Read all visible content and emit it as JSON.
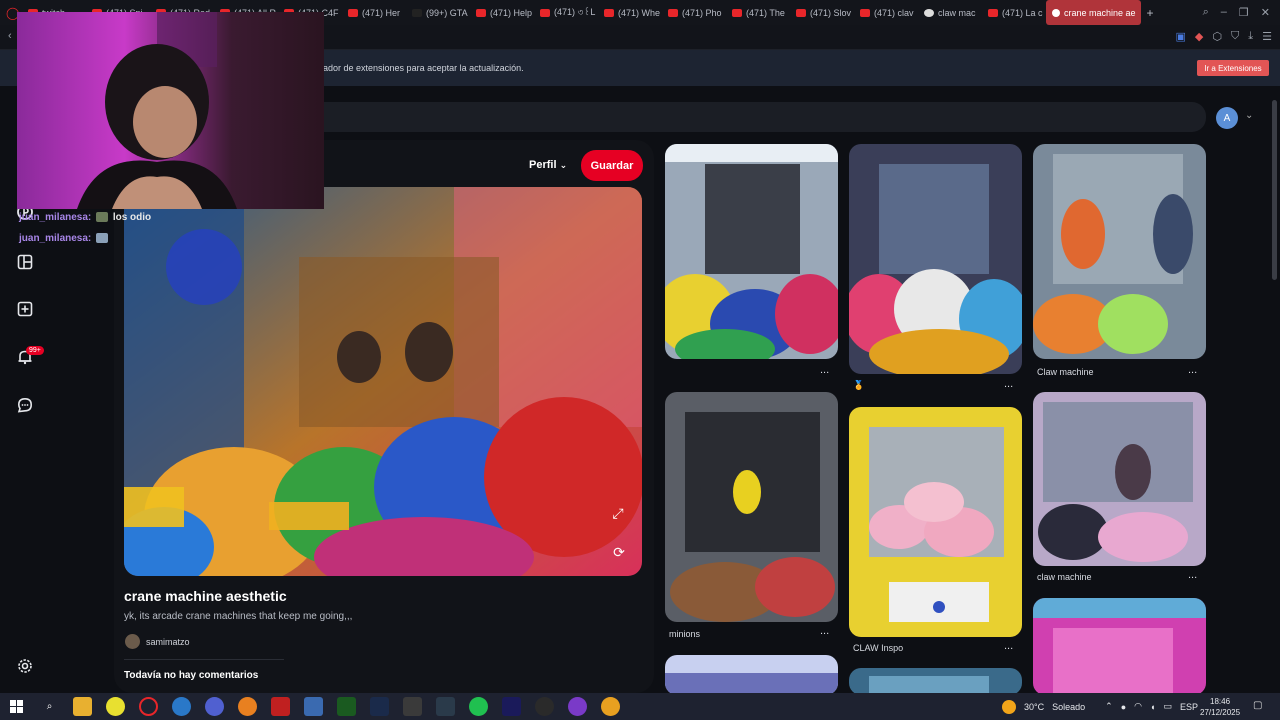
{
  "browser": {
    "tabs": [
      {
        "label": "twitch"
      },
      {
        "label": "(471) Spi"
      },
      {
        "label": "(471) Red"
      },
      {
        "label": "(471) All R"
      },
      {
        "label": "(471) C4F"
      },
      {
        "label": "(471) Her"
      },
      {
        "label": "(99+) GTA"
      },
      {
        "label": "(471) Help"
      },
      {
        "label": "(471) ৩꒰L"
      },
      {
        "label": "(471) Whe"
      },
      {
        "label": "(471) Pho"
      },
      {
        "label": "(471) The"
      },
      {
        "label": "(471) Slov"
      },
      {
        "label": "(471) clav"
      },
      {
        "label": "claw mac"
      },
      {
        "label": "(471) La c"
      }
    ],
    "active_tab": "crane machine ae",
    "new_tab": "+"
  },
  "notice": {
    "text": "ador de extensiones para aceptar la actualización.",
    "button": "Ir a Extensiones"
  },
  "account": {
    "initial": "A"
  },
  "rail": {
    "notifications_badge": "99+"
  },
  "pin": {
    "profile_label": "Perfil",
    "save_label": "Guardar",
    "title": "crane machine aesthetic",
    "description": "yk, its arcade crane machines that keep me going,,,",
    "author": "samimatzo",
    "comments": "Todavía no hay comentarios"
  },
  "chat": [
    {
      "user": "juan_milanesa:",
      "msg": "los odio"
    },
    {
      "user": "juan_milanesa:",
      "msg": ""
    }
  ],
  "grid": {
    "captions": {
      "c2": "🏅",
      "c3": "Claw machine",
      "c4": "minions",
      "c5": "CLAW Inspo",
      "c6": "claw machine"
    },
    "more": "..."
  },
  "taskbar": {
    "temperature": "30°C",
    "weather": "Soleado",
    "lang": "ESP",
    "time": "18:46",
    "date": "27/12/2025"
  },
  "colors": {
    "accent": "#e60023",
    "background": "#0d0f14"
  }
}
